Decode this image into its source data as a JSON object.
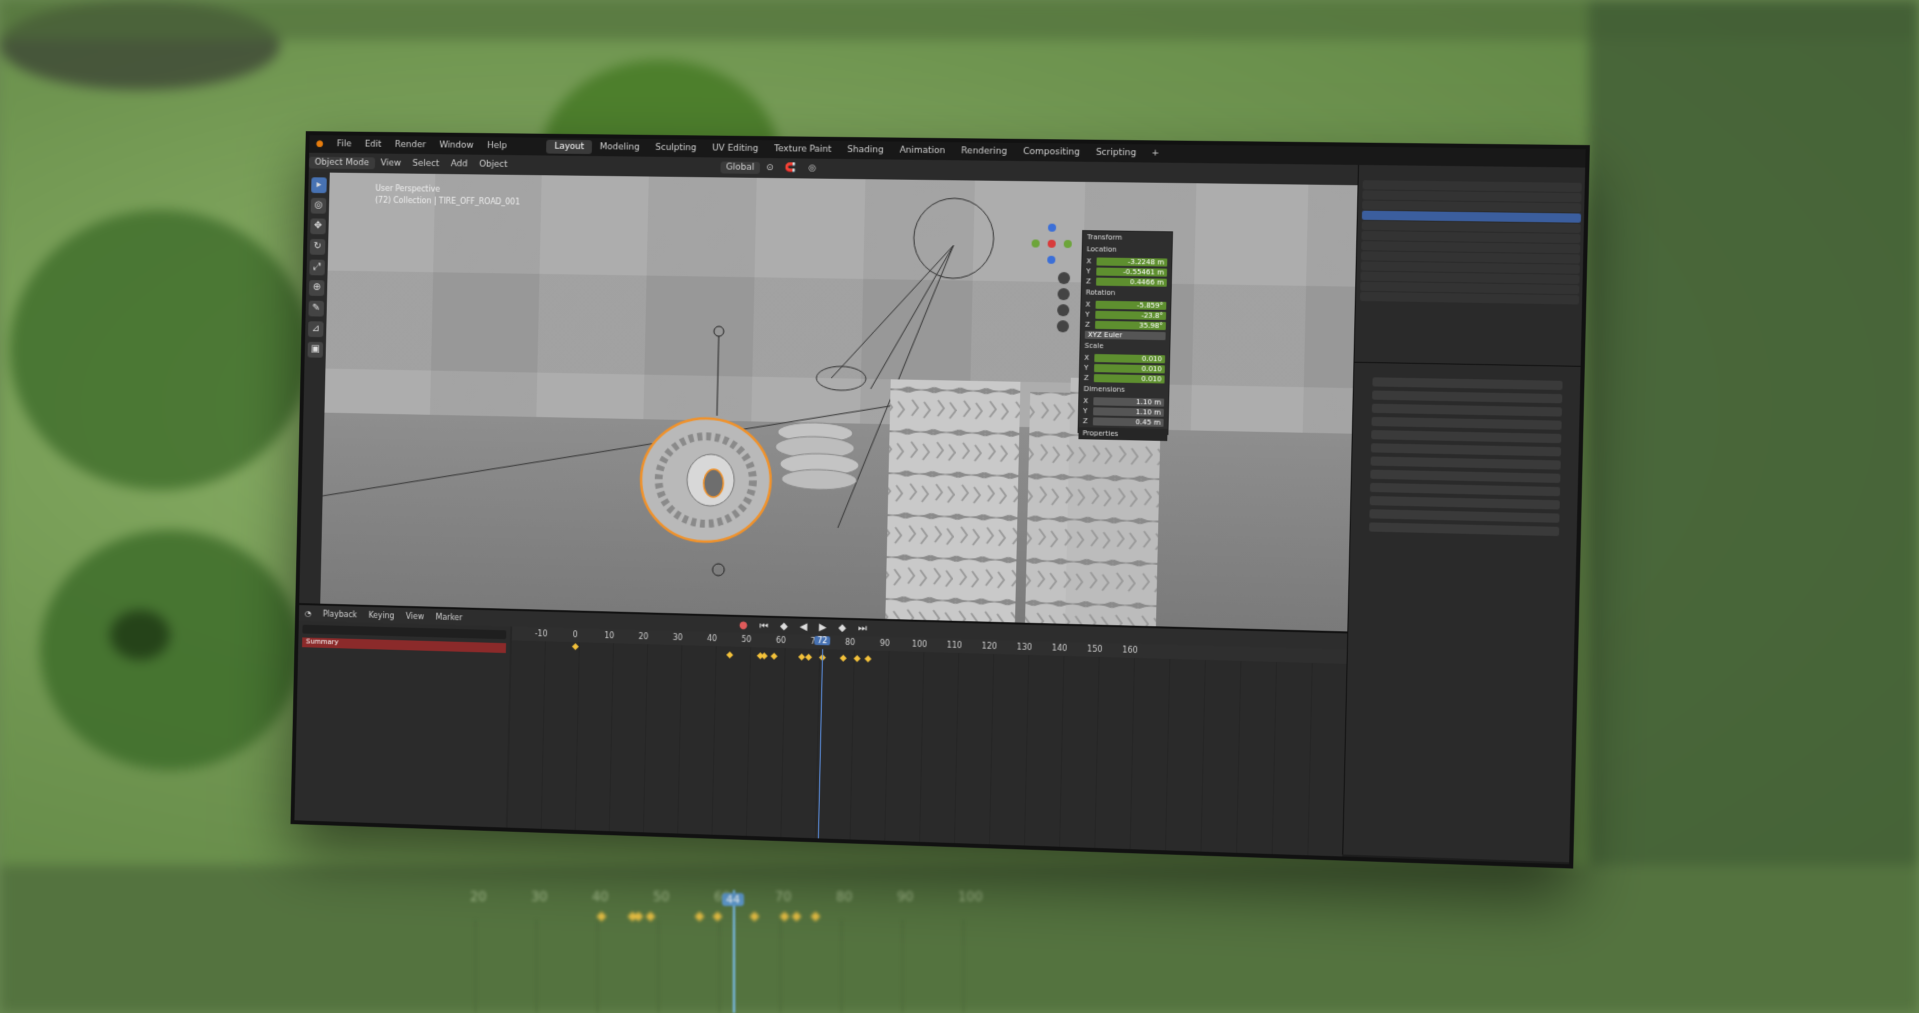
{
  "menu": {
    "items": [
      "File",
      "Edit",
      "Render",
      "Window",
      "Help"
    ],
    "workspaces": [
      "Layout",
      "Modeling",
      "Sculpting",
      "UV Editing",
      "Texture Paint",
      "Shading",
      "Animation",
      "Rendering",
      "Compositing",
      "Scripting"
    ],
    "active_workspace": "Layout"
  },
  "header": {
    "mode": "Object Mode",
    "items": [
      "View",
      "Select",
      "Add",
      "Object"
    ],
    "orientation": "Global"
  },
  "viewport": {
    "info_line1": "User Perspective",
    "info_line2": "(72) Collection | TIRE_OFF_ROAD_001",
    "tools": [
      "select",
      "cursor",
      "move",
      "rotate",
      "scale",
      "transform",
      "annotate",
      "measure",
      "add-cube"
    ]
  },
  "npanel": {
    "title": "Transform",
    "location_label": "Location",
    "location": [
      {
        "axis": "X",
        "value": "-3.2248 m"
      },
      {
        "axis": "Y",
        "value": "-0.55461 m"
      },
      {
        "axis": "Z",
        "value": "0.4466 m"
      }
    ],
    "rotation_label": "Rotation",
    "rotation": [
      {
        "axis": "X",
        "value": "-5.859°"
      },
      {
        "axis": "Y",
        "value": "-23.8°"
      },
      {
        "axis": "Z",
        "value": "35.98°"
      }
    ],
    "rotation_mode": "XYZ Euler",
    "scale_label": "Scale",
    "scale": [
      {
        "axis": "X",
        "value": "0.010"
      },
      {
        "axis": "Y",
        "value": "0.010"
      },
      {
        "axis": "Z",
        "value": "0.010"
      }
    ],
    "dimensions_label": "Dimensions",
    "dimensions": [
      {
        "axis": "X",
        "value": "1.10 m"
      },
      {
        "axis": "Y",
        "value": "1.10 m"
      },
      {
        "axis": "Z",
        "value": "0.45 m"
      }
    ],
    "properties_label": "Properties"
  },
  "timeline": {
    "menu": [
      "Playback",
      "Keying",
      "View",
      "Marker"
    ],
    "summary_label": "Summary",
    "ruler": [
      -10,
      0,
      10,
      20,
      30,
      40,
      50,
      60,
      70,
      80,
      90,
      100,
      110,
      120,
      130,
      140,
      150,
      160
    ],
    "current_frame": 72,
    "keyframes": [
      0,
      45,
      54,
      55,
      58,
      66,
      68,
      72,
      78,
      82,
      85
    ],
    "bg_ruler": [
      20,
      30,
      40,
      50,
      60,
      70,
      80,
      90,
      100
    ],
    "bg_keyframes": [
      41,
      46,
      47,
      49,
      57,
      60,
      66,
      71,
      73,
      76
    ],
    "bg_current_frame": "44"
  },
  "colors": {
    "accent": "#4772b3",
    "keyframe": "#f3c13a",
    "field_green": "#5e8f2f",
    "background_green": "#6f9550"
  }
}
